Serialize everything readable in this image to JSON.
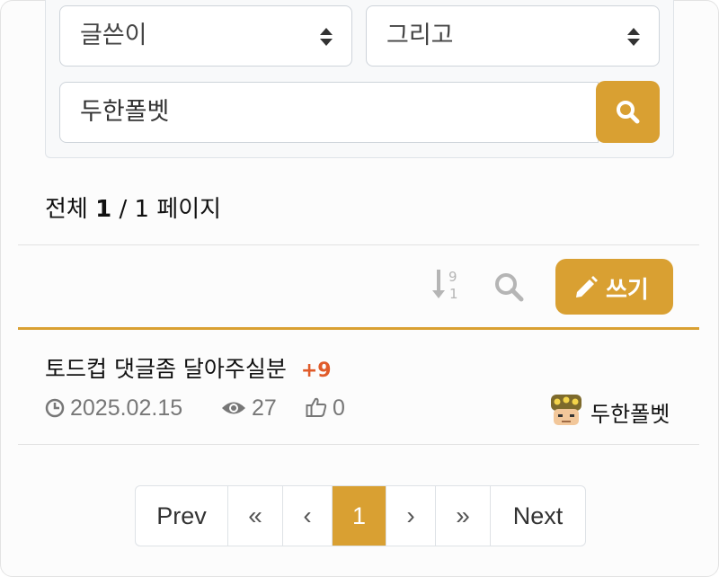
{
  "search": {
    "field_select": "글쓴이",
    "operator_select": "그리고",
    "query": "두한폴벳"
  },
  "paging_summary": {
    "prefix": "전체",
    "current": "1",
    "separator": "/",
    "total": "1",
    "suffix": "페이지"
  },
  "toolbar": {
    "write_label": "쓰기"
  },
  "posts": [
    {
      "title": "토드컵 댓글좀 달아주실분",
      "comment_count": "+9",
      "date": "2025.02.15",
      "views": "27",
      "likes": "0",
      "author": "두한폴벳"
    }
  ],
  "pagination": {
    "prev_label": "Prev",
    "first_label": "«",
    "prev_arrow": "‹",
    "current_page": "1",
    "next_arrow": "›",
    "last_label": "»",
    "next_label": "Next"
  },
  "colors": {
    "accent": "#d9a032",
    "comment_count": "#e05b2a",
    "meta_text": "#777777"
  },
  "icons": [
    "sort-numeric-icon",
    "search-icon",
    "pencil-icon",
    "clock-icon",
    "eye-icon",
    "thumbs-up-icon",
    "avatar-icon",
    "select-arrows-icon"
  ]
}
